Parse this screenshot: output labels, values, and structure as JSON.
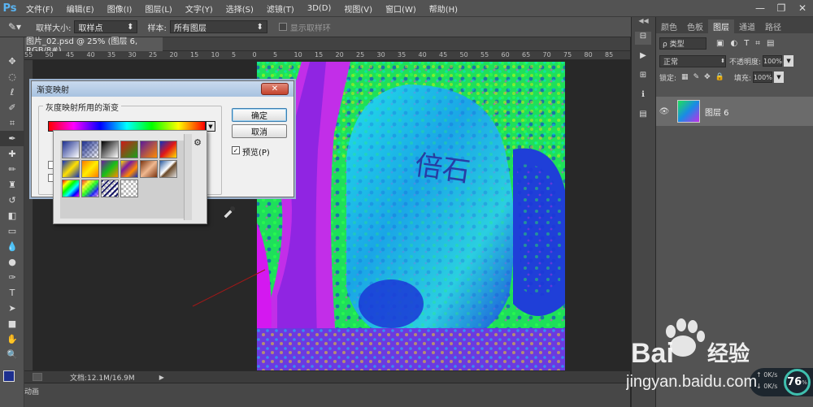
{
  "menubar": {
    "logo": "Ps",
    "items": [
      "文件(F)",
      "编辑(E)",
      "图像(I)",
      "图层(L)",
      "文字(Y)",
      "选择(S)",
      "滤镜(T)",
      "3D(D)",
      "视图(V)",
      "窗口(W)",
      "帮助(H)"
    ],
    "window_controls": [
      "—",
      "❐",
      "✕"
    ]
  },
  "options": {
    "sample_size_label": "取样大小:",
    "sample_size_value": "取样点",
    "sample_label": "样本:",
    "sample_value": "所有图层",
    "show_ring_label": "显示取样环"
  },
  "document": {
    "tab_title": "图片_02.psd @ 25% (图层 6, RGB/8#)",
    "ruler_marks": [
      "55",
      "50",
      "45",
      "40",
      "35",
      "30",
      "25",
      "20",
      "15",
      "10",
      "5",
      "0",
      "5",
      "10",
      "15",
      "20",
      "25",
      "30",
      "35",
      "40",
      "45",
      "50",
      "55",
      "60",
      "65",
      "70",
      "75",
      "80",
      "85"
    ],
    "status_zoom": "",
    "status_doc": "文档:12.1M/16.9M",
    "bottom_tab": "动画"
  },
  "dialog": {
    "title": "渐变映射",
    "group_label": "灰度映射所用的渐变",
    "ok_label": "确定",
    "cancel_label": "取消",
    "preview_label": "预览(P)",
    "preview_checked": true
  },
  "gradient_picker": {
    "gear": "⚙",
    "swatches": [
      "fg-bg",
      "fg-transparent",
      "black-white",
      "red-green",
      "violet-orange",
      "blue-red-yellow",
      "blue-yellow-blue",
      "orange-yellow-orange",
      "violet-green-orange",
      "yellow-violet-orange-blue",
      "copper",
      "chrome",
      "spectrum",
      "transparent-rainbow",
      "transparent-stripes",
      "empty"
    ]
  },
  "panels": {
    "tabs": [
      "颜色",
      "色板",
      "图层",
      "通道",
      "路径"
    ],
    "active_tab": "图层",
    "filter_label": "ρ 类型",
    "blend_mode": "正常",
    "opacity_label": "不透明度:",
    "opacity_value": "100%",
    "lock_label": "锁定:",
    "fill_label": "填充:",
    "fill_value": "100%",
    "layer_name": "图层 6"
  },
  "network_widget": {
    "percent": "76",
    "percent_unit": "%",
    "up": "0K/s",
    "down": "0K/s"
  },
  "watermark": {
    "brand": "Bai",
    "brand2": "经验",
    "url": "jingyan.baidu.com"
  },
  "image_text": "倍石",
  "colors": {
    "ps_bg": "#535353",
    "canvas_bg": "#282828",
    "dialog_bg": "#f0f0f0",
    "accent_blue": "#1d4fb8"
  }
}
